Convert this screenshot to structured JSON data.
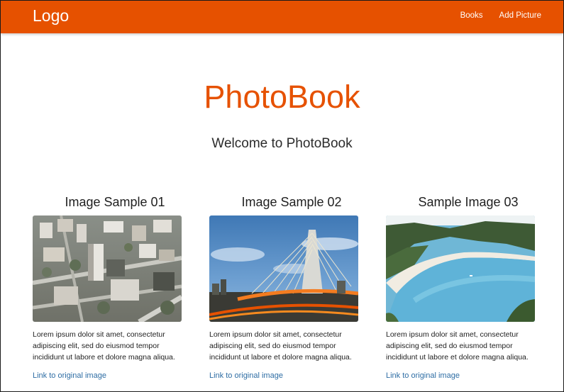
{
  "navbar": {
    "brand": "Logo",
    "links": [
      {
        "label": "Books"
      },
      {
        "label": "Add Picture"
      }
    ],
    "color": "#e65100"
  },
  "hero": {
    "title": "PhotoBook",
    "subtitle": "Welcome to PhotoBook",
    "title_color": "#e65100"
  },
  "cards": [
    {
      "title": "Image Sample 01",
      "image": "city-aerial-photo",
      "text": "Lorem ipsum dolor sit amet, consectetur adipiscing elit, sed do eiusmod tempor incididunt ut labore et dolore magna aliqua.",
      "link": "Link to original image"
    },
    {
      "title": "Image Sample 02",
      "image": "cable-bridge-photo",
      "text": "Lorem ipsum dolor sit amet, consectetur adipiscing elit, sed do eiusmod tempor incididunt ut labore et dolore magna aliqua.",
      "link": "Link to original image"
    },
    {
      "title": "Sample Image 03",
      "image": "beach-bay-photo",
      "text": "Lorem ipsum dolor sit amet, consectetur adipiscing elit, sed do eiusmod tempor incididunt ut labore et dolore magna aliqua.",
      "link": "Link to original image"
    }
  ],
  "link_color": "#2e6da4"
}
